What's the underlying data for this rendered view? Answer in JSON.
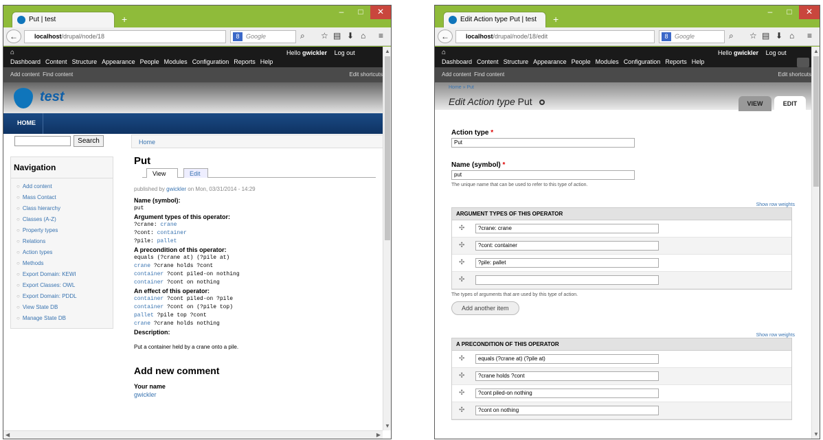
{
  "left": {
    "tab_title": "Put | test",
    "url_host": "localhost",
    "url_path": "/drupal/node/18",
    "search_placeholder": "Google",
    "admin": {
      "menu": [
        "Dashboard",
        "Content",
        "Structure",
        "Appearance",
        "People",
        "Modules",
        "Configuration",
        "Reports",
        "Help"
      ],
      "hello_prefix": "Hello",
      "user": "gwickler",
      "logout": "Log out"
    },
    "shortcuts": {
      "items": [
        "Add content",
        "Find content"
      ],
      "edit": "Edit shortcuts"
    },
    "site_name": "test",
    "main_menu": "HOME",
    "search_button": "Search",
    "nav_title": "Navigation",
    "nav_items": [
      "Add content",
      "Mass Contact",
      "Class hierarchy",
      "Classes (A-Z)",
      "Property types",
      "Relations",
      "Action types",
      "Methods",
      "Export Domain: KEWI",
      "Export Classes: OWL",
      "Export Domain: PDDL",
      "View State DB",
      "Manage State DB"
    ],
    "breadcrumb": "Home",
    "page_title": "Put",
    "tabs": [
      "View",
      "Edit"
    ],
    "published_prefix": "published by",
    "published_user": "gwickler",
    "published_suffix": "on Mon, 03/31/2014 - 14:29",
    "name_label": "Name (symbol):",
    "name_value": "put",
    "arg_label": "Argument types of this operator:",
    "args": [
      {
        "var": "?crane",
        "type": "crane"
      },
      {
        "var": "?cont",
        "type": "container"
      },
      {
        "var": "?pile",
        "type": "pallet"
      }
    ],
    "pre_label": "A precondition of this operator:",
    "pre": [
      {
        "link": "",
        "text": "equals (?crane at) (?pile at)"
      },
      {
        "link": "crane",
        "text": " ?crane holds ?cont"
      },
      {
        "link": "container",
        "text": " ?cont piled-on nothing"
      },
      {
        "link": "container",
        "text": " ?cont on nothing"
      }
    ],
    "eff_label": "An effect of this operator:",
    "eff": [
      {
        "link": "container",
        "text": " ?cont piled-on ?pile"
      },
      {
        "link": "container",
        "text": " ?cont on (?pile top)"
      },
      {
        "link": "pallet",
        "text": " ?pile top ?cont"
      },
      {
        "link": "crane",
        "text": " ?crane holds nothing"
      }
    ],
    "desc_label": "Description:",
    "desc_text": "Put a container held by a crane onto a pile.",
    "add_comment": "Add new comment",
    "your_name": "Your name",
    "your_name_value": "gwickler"
  },
  "right": {
    "tab_title": "Edit Action type Put | test",
    "url_host": "localhost",
    "url_path": "/drupal/node/18/edit",
    "search_placeholder": "Google",
    "breadcrumb": "Home » Put",
    "title_prefix": "Edit Action type",
    "title_name": "Put",
    "tabs": [
      "VIEW",
      "EDIT"
    ],
    "action_type_label": "Action type",
    "action_type_value": "Put",
    "name_label": "Name (symbol)",
    "name_value": "put",
    "name_desc": "The unique name that can be used to refer to this type of action.",
    "show_row_weights": "Show row weights",
    "arg_header": "ARGUMENT TYPES OF THIS OPERATOR",
    "arg_rows": [
      "?crane: crane",
      "?cont: container",
      "?pile: pallet",
      ""
    ],
    "arg_desc": "The types of arguments that are used by this type of action.",
    "add_another": "Add another item",
    "pre_header": "A PRECONDITION OF THIS OPERATOR",
    "pre_rows": [
      "equals (?crane at) (?pile at)",
      "?crane holds ?cont",
      "?cont piled-on nothing",
      "?cont on nothing"
    ]
  },
  "icons": [
    "firefox-icon",
    "back-icon",
    "globe-icon",
    "search-icon",
    "star-icon",
    "bookmarks-icon",
    "download-icon",
    "home-icon",
    "menu-icon",
    "drupal-logo",
    "drag-handle-icon",
    "gear-icon"
  ]
}
